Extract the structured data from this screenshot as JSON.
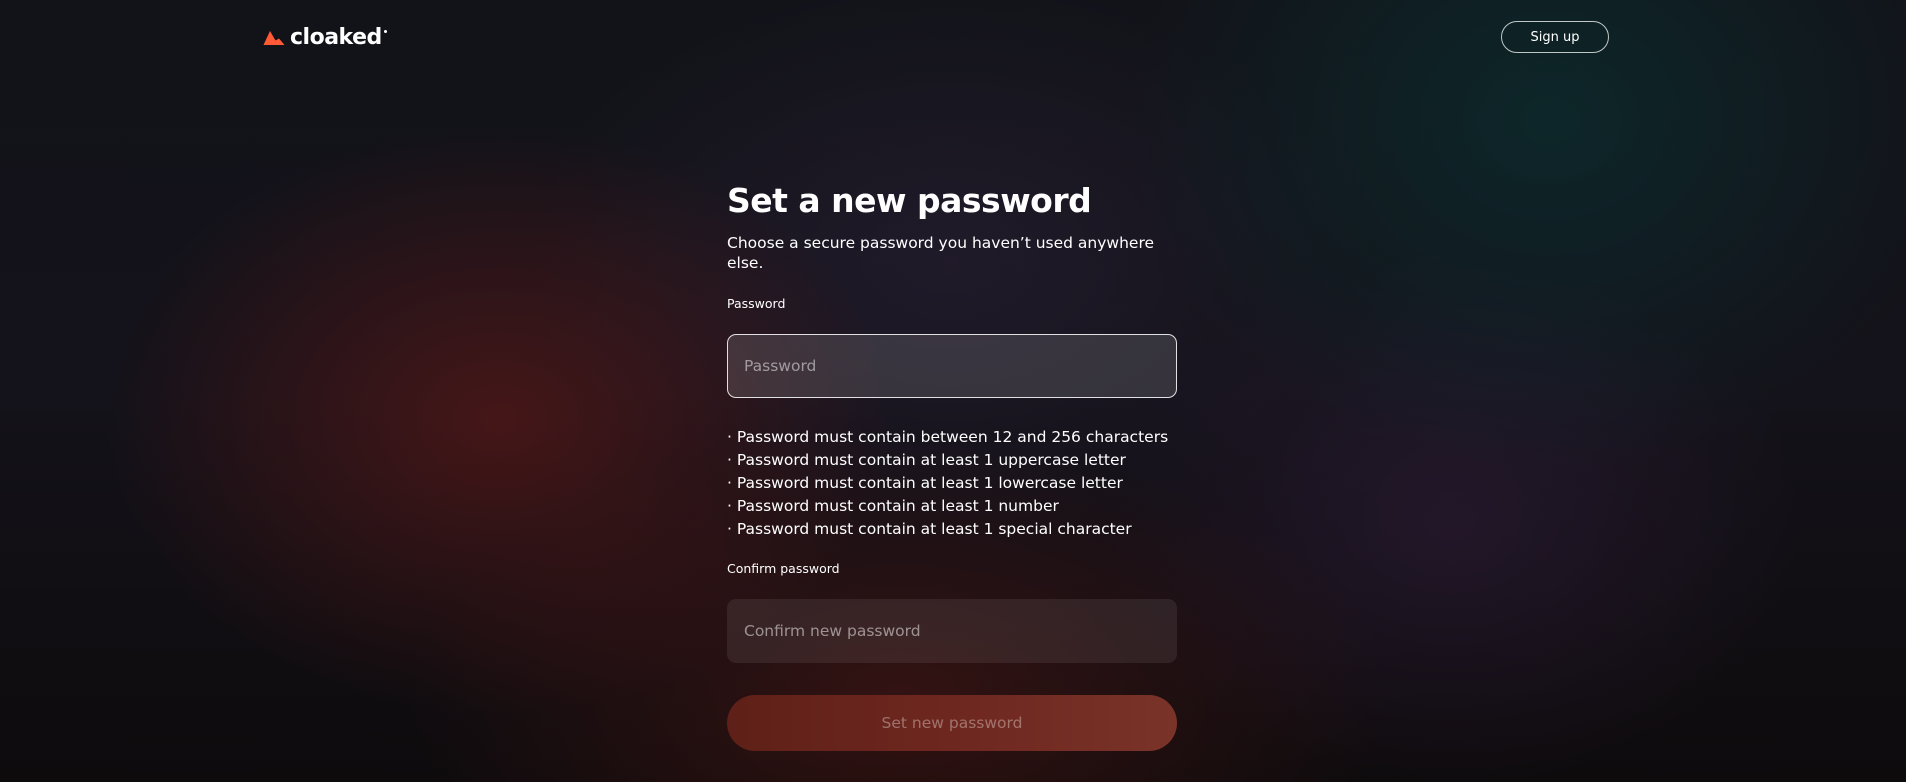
{
  "header": {
    "logo_text": "cloaked",
    "signup_label": "Sign up"
  },
  "form": {
    "title": "Set a new password",
    "subtitle": "Choose a secure password you haven’t used anywhere else.",
    "password_label": "Password",
    "password_placeholder": "Password",
    "rules": [
      "· Password must contain between 12 and 256 characters",
      "· Password must contain at least 1 uppercase letter",
      "· Password must contain at least 1 lowercase letter",
      "· Password must contain at least 1 number",
      "· Password must contain at least 1 special character"
    ],
    "confirm_label": "Confirm password",
    "confirm_placeholder": "Confirm new password",
    "submit_label": "Set new password"
  },
  "colors": {
    "brand_accent": "#ff5a36",
    "submit_disabled": "#6e271f"
  },
  "icons": {
    "logo": "cloaked-logo-icon"
  }
}
